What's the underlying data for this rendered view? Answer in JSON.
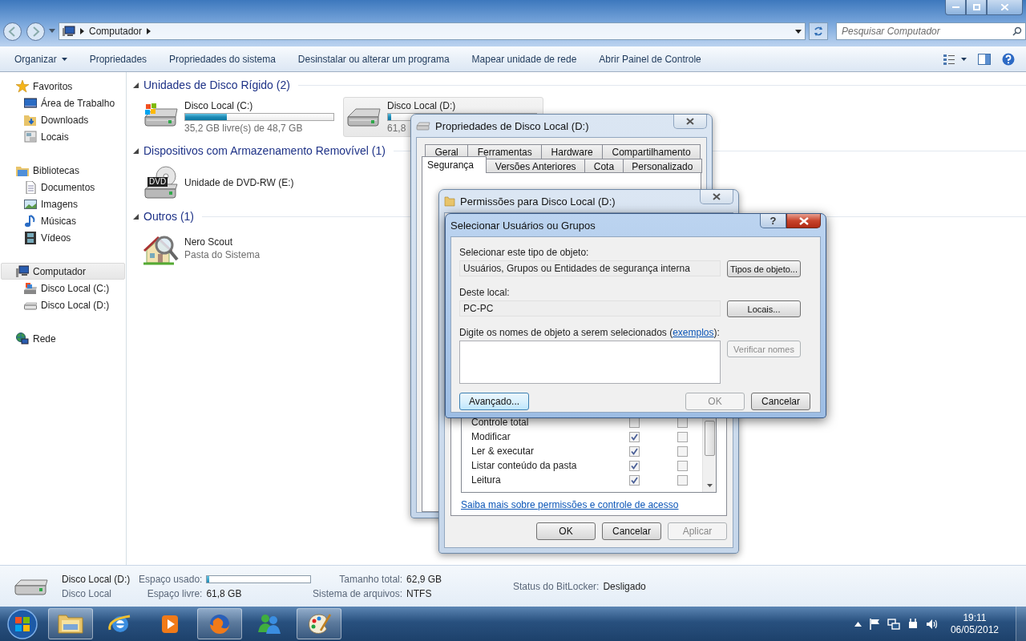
{
  "address_bar": {
    "segments": [
      "Computador"
    ]
  },
  "search": {
    "placeholder": "Pesquisar Computador"
  },
  "toolbar": {
    "items": [
      {
        "label": "Organizar",
        "kind": "menu"
      },
      {
        "label": "Propriedades",
        "kind": "button"
      },
      {
        "label": "Propriedades do sistema",
        "kind": "button"
      },
      {
        "label": "Desinstalar ou alterar um programa",
        "kind": "button"
      },
      {
        "label": "Mapear unidade de rede",
        "kind": "button"
      },
      {
        "label": "Abrir Painel de Controle",
        "kind": "button"
      }
    ]
  },
  "nav": {
    "groups": [
      {
        "label": "Favoritos",
        "selected": false,
        "children": [
          {
            "label": "Área de Trabalho",
            "selected": false
          },
          {
            "label": "Downloads",
            "selected": false
          },
          {
            "label": "Locais",
            "selected": false
          }
        ]
      },
      {
        "label": "Bibliotecas",
        "selected": false,
        "children": [
          {
            "label": "Documentos",
            "selected": false
          },
          {
            "label": "Imagens",
            "selected": false
          },
          {
            "label": "Músicas",
            "selected": false
          },
          {
            "label": "Vídeos",
            "selected": false
          }
        ]
      },
      {
        "label": "Computador",
        "selected": true,
        "children": [
          {
            "label": "Disco Local (C:)",
            "selected": false
          },
          {
            "label": "Disco Local (D:)",
            "selected": false
          }
        ]
      },
      {
        "label": "Rede",
        "selected": false
      }
    ]
  },
  "content": {
    "sections": [
      {
        "title": "Unidades de Disco Rígido (2)",
        "items": [
          {
            "kind": "system_drive",
            "name": "Disco Local (C:)",
            "level": 0.28,
            "detail": "35,2 GB livre(s) de 48,7 GB",
            "selected": false
          },
          {
            "kind": "drive",
            "name": "Disco Local (D:)",
            "level": 0.02,
            "detail": "61,8",
            "selected": true
          }
        ]
      },
      {
        "title": "Dispositivos com Armazenamento Removível (1)",
        "items": [
          {
            "kind": "optical",
            "name": "Unidade de DVD-RW (E:)",
            "badge": "DVD",
            "selected": false
          }
        ]
      },
      {
        "title": "Outros (1)",
        "items": [
          {
            "kind": "system_folder",
            "name": "Nero Scout",
            "detail": "Pasta do Sistema",
            "selected": false
          }
        ]
      }
    ]
  },
  "details": {
    "name": "Disco Local (D:)",
    "type": "Disco Local",
    "columns": [
      [
        {
          "label": "Espaço usado:",
          "kind": "meter",
          "level": 0.02
        },
        {
          "label": "Espaço livre:",
          "kind": "text",
          "value": "61,8 GB"
        }
      ],
      [
        {
          "label": "Tamanho total:",
          "kind": "text",
          "value": "62,9 GB"
        },
        {
          "label": "Sistema de arquivos:",
          "kind": "text",
          "value": "NTFS"
        }
      ],
      [
        {
          "label": "Status do BitLocker:",
          "kind": "text",
          "value": "Desligado"
        }
      ]
    ]
  },
  "taskbar": {
    "apps": [
      {
        "open": true
      },
      {
        "open": false
      },
      {
        "open": false
      },
      {
        "open": true
      },
      {
        "open": false
      },
      {
        "open": true
      }
    ],
    "clock": {
      "time": "19:11",
      "date": "06/05/2012"
    }
  },
  "properties_dialog": {
    "title": "Propriedades de Disco Local (D:)",
    "tab_rows": [
      [
        {
          "label": "Geral",
          "selected": false
        },
        {
          "label": "Ferramentas",
          "selected": false
        },
        {
          "label": "Hardware",
          "selected": false
        },
        {
          "label": "Compartilhamento",
          "selected": false
        }
      ],
      [
        {
          "label": "Segurança",
          "selected": true
        },
        {
          "label": "Versões Anteriores",
          "selected": false
        },
        {
          "label": "Cota",
          "selected": false
        },
        {
          "label": "Personalizado",
          "selected": false
        }
      ]
    ]
  },
  "permissions_dialog": {
    "title": "Permissões para Disco Local (D:)",
    "permissions": [
      {
        "name": "Controle total",
        "allow": false,
        "deny": false
      },
      {
        "name": "Modificar",
        "allow": true,
        "deny": false
      },
      {
        "name": "Ler & executar",
        "allow": true,
        "deny": false
      },
      {
        "name": "Listar conteúdo da pasta",
        "allow": true,
        "deny": false
      },
      {
        "name": "Leitura",
        "allow": true,
        "deny": false
      }
    ],
    "help_link": "Saiba mais sobre permissões e controle de acesso",
    "buttons": [
      {
        "label": "OK",
        "disabled": false
      },
      {
        "label": "Cancelar",
        "disabled": false
      },
      {
        "label": "Aplicar",
        "disabled": true
      }
    ]
  },
  "select_dialog": {
    "title": "Selecionar Usuários ou Grupos",
    "help_button": "?",
    "object_type": {
      "label": "Selecionar este tipo de objeto:",
      "value": "Usuários, Grupos ou Entidades de segurança interna",
      "button": "Tipos de objeto..."
    },
    "location": {
      "label": "Deste local:",
      "value": "PC-PC",
      "button": "Locais..."
    },
    "names": {
      "label_before": "Digite os nomes de objeto a serem selecionados (",
      "link": "exemplos",
      "label_after": "):",
      "button": "Verificar nomes",
      "button_disabled": true
    },
    "buttons": [
      {
        "label": "Avançado...",
        "disabled": false,
        "focused": true
      },
      {
        "label": "OK",
        "disabled": true,
        "focused": false
      },
      {
        "label": "Cancelar",
        "disabled": false,
        "focused": false
      }
    ]
  }
}
